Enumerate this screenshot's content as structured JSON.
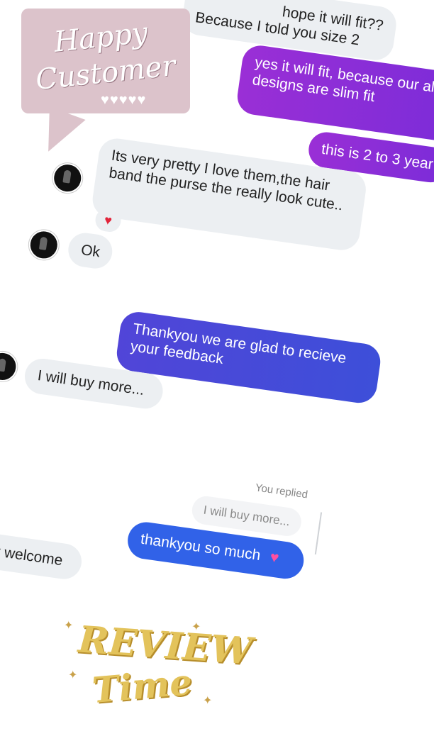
{
  "chat": {
    "top_partial_1": "hope it will fit??",
    "top_partial_2": "Because I told you size 2",
    "msg_fit": "yes it will fit, because our all designs are slim fit",
    "msg_size": "this is 2 to 3 year",
    "msg_pretty": "Its very pretty I love them,the hair band the purse the really look cute..",
    "msg_ok": "Ok",
    "msg_thanks_feedback": "Thankyou we are glad to recieve your feedback",
    "msg_buy_more": "I will buy more...",
    "you_replied": "You replied",
    "quoted_reply": "I will buy more...",
    "msg_thankyou": "thankyou so much",
    "msg_welcome": "Your welcome"
  },
  "stickers": {
    "happy_1": "Happy",
    "happy_2": "Customer",
    "hearts": "♥♥♥♥♥",
    "review_1": "REVIEW",
    "review_2": "Time"
  },
  "colors": {
    "purple": "#9a2fd6",
    "indigo": "#5145d8",
    "blue": "#3162e8",
    "heart_red": "#e2243a",
    "sticker_pink": "#dcc3cb",
    "sticker_gold": "#e3c35b"
  }
}
